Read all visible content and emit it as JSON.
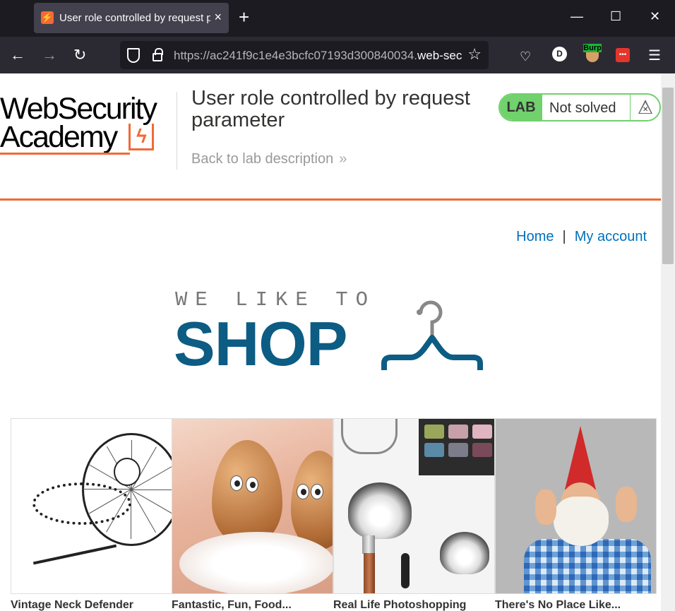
{
  "browser": {
    "tab_title": "User role controlled by request parameter",
    "tab_close": "×",
    "new_tab": "+",
    "url_prefix": "https://ac241f9c1e4e3bcfc07193d300840034.",
    "url_domain": "web-security-academy.net",
    "ext_d": "D",
    "ext_burp": "Burp",
    "ext_red": "•••"
  },
  "header": {
    "logo_line1": "WebSecurity",
    "logo_line2": "Academy",
    "lab_title": "User role controlled by request parameter",
    "back_link": "Back to lab description",
    "back_chevron": "»",
    "status_label": "LAB",
    "status_text": "Not solved"
  },
  "nav": {
    "home": "Home",
    "separator": "|",
    "my_account": "My account"
  },
  "banner": {
    "top_text": "WE LIKE TO",
    "main_text": "SHOP"
  },
  "products": [
    {
      "name": "Vintage Neck Defender"
    },
    {
      "name": "Fantastic, Fun, Food..."
    },
    {
      "name": "Real Life Photoshopping"
    },
    {
      "name": "There's No Place Like..."
    }
  ],
  "colors": {
    "accent_orange": "#f26a35",
    "link_blue": "#0071bc",
    "shop_blue": "#0c5c84",
    "lab_green": "#70d16d"
  }
}
